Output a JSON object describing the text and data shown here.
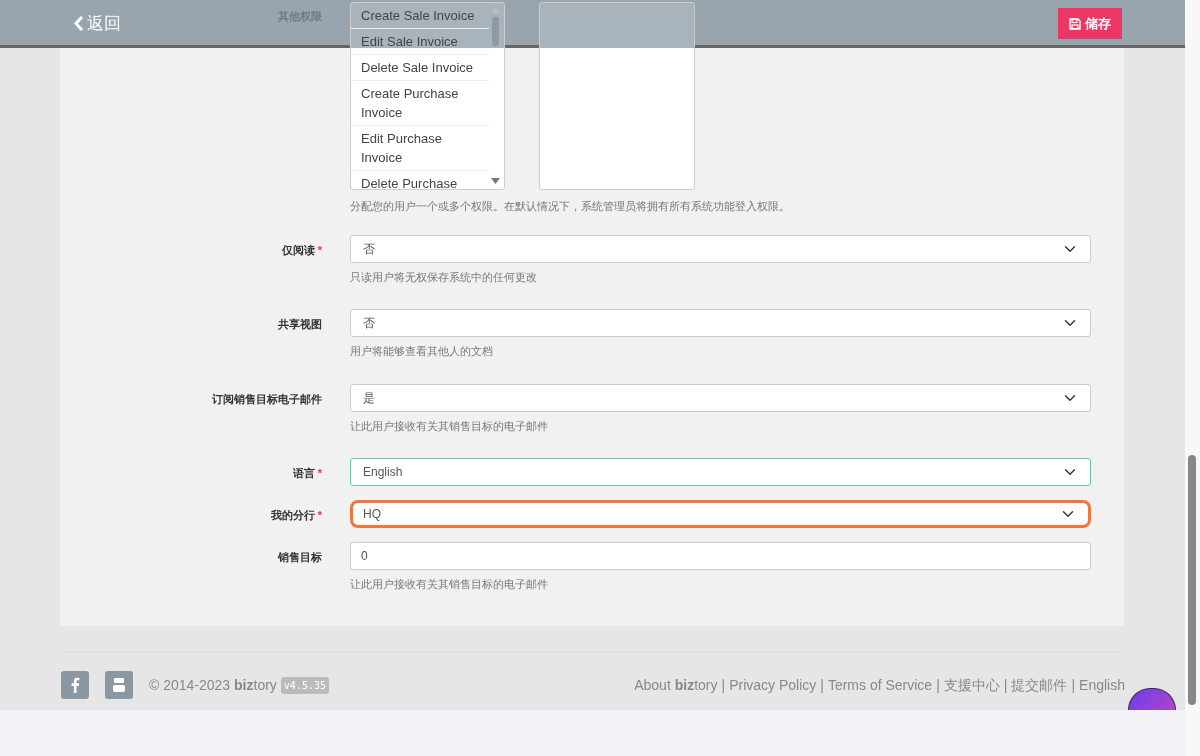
{
  "header": {
    "back": "返回",
    "save": "储存"
  },
  "permissions": {
    "label": "其他权限",
    "options": [
      "Create Sale Invoice",
      "Edit Sale Invoice",
      "Delete Sale Invoice",
      "Create Purchase Invoice",
      "Edit Purchase Invoice",
      "Delete Purchase"
    ],
    "help": "分配您的用户一个或多个权限。在默认情况下，系统管理员将拥有所有系统功能登入权限。"
  },
  "fields": [
    {
      "kind": "select",
      "label": "仅阅读",
      "required_mark": "*",
      "value": "否",
      "help": "只读用户将无权保存系统中的任何更改",
      "valid": false,
      "focused": false
    },
    {
      "kind": "select",
      "label": "共享视图",
      "value": "否",
      "help": "用户将能够查看其他人的文档",
      "valid": false,
      "focused": false
    },
    {
      "kind": "select",
      "label": "订阅销售目标电子邮件",
      "value": "是",
      "help": "让此用户接收有关其销售目标的电子邮件",
      "valid": false,
      "focused": false
    },
    {
      "kind": "select",
      "label": "语言",
      "required_mark": "*",
      "value": "English",
      "valid": true,
      "focused": false
    },
    {
      "kind": "select",
      "label": "我的分行",
      "required_mark": "*",
      "value": "HQ",
      "valid": false,
      "focused": true
    },
    {
      "kind": "text",
      "label": "销售目标",
      "value": "0",
      "help": "让此用户接收有关其销售目标的电子邮件",
      "valid": false,
      "focused": false
    }
  ],
  "footer": {
    "copyright": "© 2014-2023 **biz**tory",
    "version": "v4.5.35",
    "separator": "|",
    "links": [
      "About **biz**tory",
      "Privacy Policy",
      "Terms of Service",
      "支援中心",
      "提交邮件",
      "English"
    ]
  }
}
